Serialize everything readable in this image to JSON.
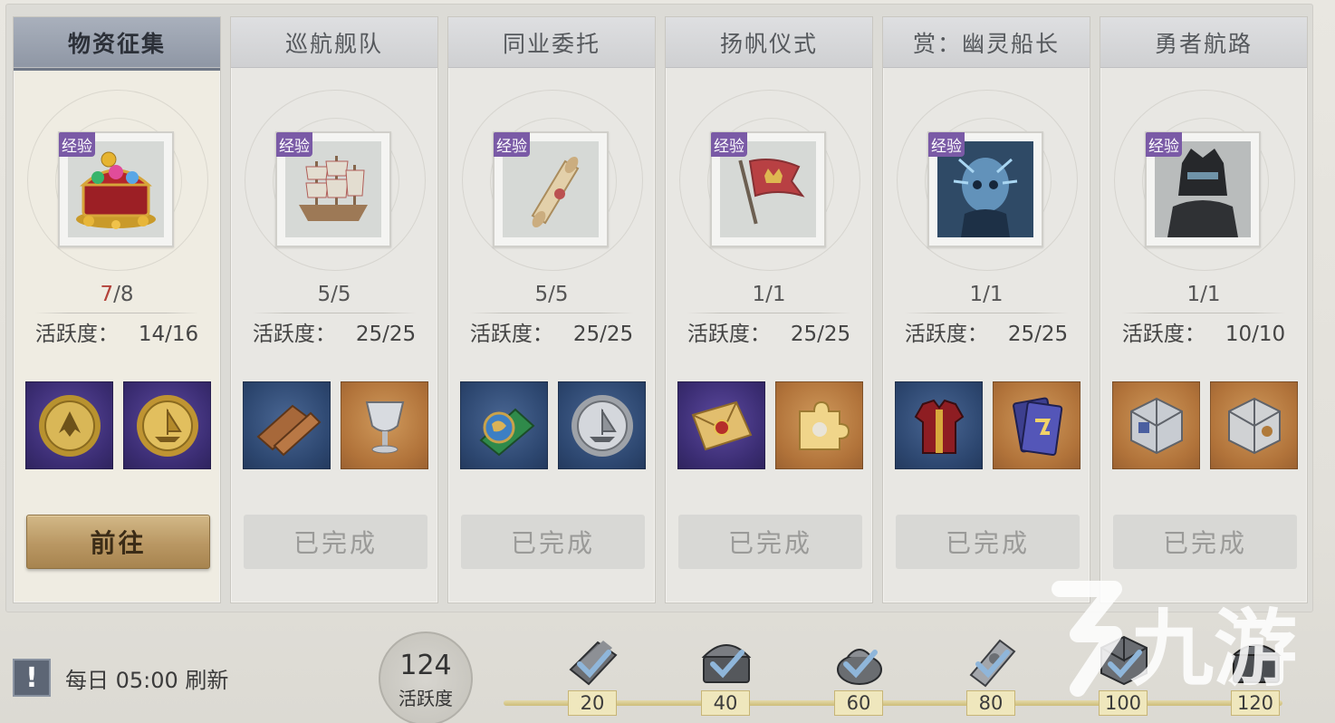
{
  "tasks": [
    {
      "title": "物资征集",
      "badge": "经验",
      "icon": "treasure-chest-icon",
      "progress_current": "7",
      "progress_total": "/8",
      "activity_label": "活跃度：",
      "activity_value": "14/16",
      "rewards": [
        {
          "icon": "guild-emblem-coin-icon",
          "rarity": "purple"
        },
        {
          "icon": "gold-ship-coin-icon",
          "rarity": "purple"
        }
      ],
      "button_label": "前往",
      "status": "go"
    },
    {
      "title": "巡航舰队",
      "badge": "经验",
      "icon": "sailing-ship-icon",
      "progress_current": "5",
      "progress_total": "/5",
      "activity_label": "活跃度：",
      "activity_value": "25/25",
      "rewards": [
        {
          "icon": "wood-planks-icon",
          "rarity": "blue"
        },
        {
          "icon": "silver-goblet-icon",
          "rarity": "orange"
        }
      ],
      "button_label": "已完成",
      "status": "done"
    },
    {
      "title": "同业委托",
      "badge": "经验",
      "icon": "scroll-icon",
      "progress_current": "5",
      "progress_total": "/5",
      "activity_label": "活跃度：",
      "activity_value": "25/25",
      "rewards": [
        {
          "icon": "globe-map-icon",
          "rarity": "blue"
        },
        {
          "icon": "silver-ship-coin-icon",
          "rarity": "blue"
        }
      ],
      "button_label": "已完成",
      "status": "done"
    },
    {
      "title": "扬帆仪式",
      "badge": "经验",
      "icon": "crown-flag-icon",
      "progress_current": "1",
      "progress_total": "/1",
      "activity_label": "活跃度：",
      "activity_value": "25/25",
      "rewards": [
        {
          "icon": "sealed-letter-icon",
          "rarity": "purple"
        },
        {
          "icon": "puzzle-piece-icon",
          "rarity": "orange"
        }
      ],
      "button_label": "已完成",
      "status": "done"
    },
    {
      "title": "赏：幽灵船长",
      "badge": "经验",
      "icon": "ghost-captain-icon",
      "progress_current": "1",
      "progress_total": "/1",
      "activity_label": "活跃度：",
      "activity_value": "25/25",
      "rewards": [
        {
          "icon": "red-armor-icon",
          "rarity": "blue"
        },
        {
          "icon": "card-pack-icon",
          "rarity": "orange"
        }
      ],
      "button_label": "已完成",
      "status": "done"
    },
    {
      "title": "勇者航路",
      "badge": "经验",
      "icon": "dark-knight-icon",
      "progress_current": "1",
      "progress_total": "/1",
      "activity_label": "活跃度：",
      "activity_value": "10/10",
      "rewards": [
        {
          "icon": "silver-cube-box-icon",
          "rarity": "orange"
        },
        {
          "icon": "silver-cube-box-icon",
          "rarity": "orange"
        }
      ],
      "button_label": "已完成",
      "status": "done"
    }
  ],
  "refresh": {
    "prefix": "!",
    "text": "每日 05:00 刷新"
  },
  "activity_total": {
    "value": "124",
    "label": "活跃度"
  },
  "milestones": [
    {
      "value": "20",
      "icon": "wood-crate-icon",
      "claimed": true
    },
    {
      "value": "40",
      "icon": "open-chest-icon",
      "claimed": true
    },
    {
      "value": "60",
      "icon": "silver-pouch-icon",
      "claimed": true
    },
    {
      "value": "80",
      "icon": "scroll-reward-icon",
      "claimed": true
    },
    {
      "value": "100",
      "icon": "silver-cube-icon",
      "claimed": true
    },
    {
      "value": "120",
      "icon": "silver-chest-icon",
      "claimed": true
    }
  ],
  "watermark": "九游"
}
